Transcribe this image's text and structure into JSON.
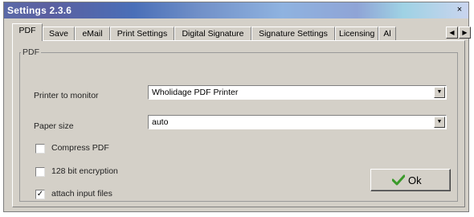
{
  "window": {
    "title": "Settings 2.3.6",
    "close_glyph": "×"
  },
  "tabs": [
    {
      "label": "PDF",
      "active": true
    },
    {
      "label": "Save"
    },
    {
      "label": "eMail"
    },
    {
      "label": "Print Settings"
    },
    {
      "label": "Digital Signature"
    },
    {
      "label": "Signature Settings"
    },
    {
      "label": "Licensing"
    },
    {
      "label": "Al"
    }
  ],
  "tab_scroll": {
    "left": "◀",
    "right": "▶"
  },
  "group": {
    "label": "PDF"
  },
  "fields": {
    "printer_label": "Printer to monitor",
    "printer_value": "Wholidage PDF Printer",
    "paper_label": "Paper size",
    "paper_value": "auto"
  },
  "combo_arrow": "▼",
  "checkboxes": [
    {
      "label": "Compress PDF",
      "checked": false,
      "mark": ""
    },
    {
      "label": "128 bit encryption",
      "checked": false,
      "mark": ""
    },
    {
      "label": "attach input files",
      "checked": true,
      "mark": "✓"
    }
  ],
  "ok_button": {
    "label": "Ok"
  },
  "colors": {
    "check_icon": "#3a9a2a",
    "face": "#d4d0c8"
  }
}
